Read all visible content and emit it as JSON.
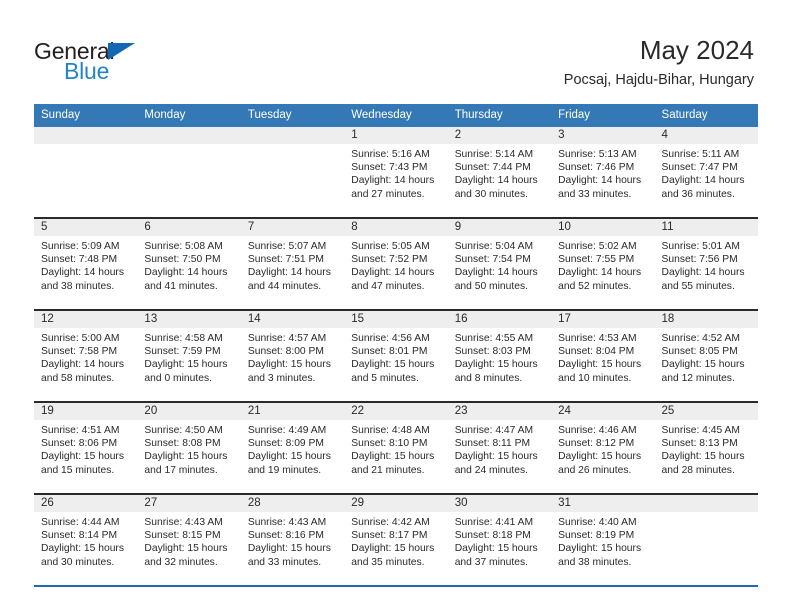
{
  "brand": {
    "name_part1": "General",
    "name_part2": "Blue",
    "accent_color": "#2484c6",
    "triangle_color": "#1268b3"
  },
  "header": {
    "month_title": "May 2024",
    "location": "Pocsaj, Hajdu-Bihar, Hungary"
  },
  "theme": {
    "header_row_color": "#3479b5",
    "daynum_band_color": "#eeeeee",
    "week_divider_color": "#2a2a2a",
    "last_week_divider_color": "#1f6ab0"
  },
  "weekday_headers": [
    "Sunday",
    "Monday",
    "Tuesday",
    "Wednesday",
    "Thursday",
    "Friday",
    "Saturday"
  ],
  "labels": {
    "sunrise": "Sunrise:",
    "sunset": "Sunset:",
    "daylight": "Daylight:"
  },
  "weeks": [
    [
      {
        "day": "",
        "empty": true
      },
      {
        "day": "",
        "empty": true
      },
      {
        "day": "",
        "empty": true
      },
      {
        "day": "1",
        "sunrise": "Sunrise: 5:16 AM",
        "sunset": "Sunset: 7:43 PM",
        "daylight": "Daylight: 14 hours and 27 minutes."
      },
      {
        "day": "2",
        "sunrise": "Sunrise: 5:14 AM",
        "sunset": "Sunset: 7:44 PM",
        "daylight": "Daylight: 14 hours and 30 minutes."
      },
      {
        "day": "3",
        "sunrise": "Sunrise: 5:13 AM",
        "sunset": "Sunset: 7:46 PM",
        "daylight": "Daylight: 14 hours and 33 minutes."
      },
      {
        "day": "4",
        "sunrise": "Sunrise: 5:11 AM",
        "sunset": "Sunset: 7:47 PM",
        "daylight": "Daylight: 14 hours and 36 minutes."
      }
    ],
    [
      {
        "day": "5",
        "sunrise": "Sunrise: 5:09 AM",
        "sunset": "Sunset: 7:48 PM",
        "daylight": "Daylight: 14 hours and 38 minutes."
      },
      {
        "day": "6",
        "sunrise": "Sunrise: 5:08 AM",
        "sunset": "Sunset: 7:50 PM",
        "daylight": "Daylight: 14 hours and 41 minutes."
      },
      {
        "day": "7",
        "sunrise": "Sunrise: 5:07 AM",
        "sunset": "Sunset: 7:51 PM",
        "daylight": "Daylight: 14 hours and 44 minutes."
      },
      {
        "day": "8",
        "sunrise": "Sunrise: 5:05 AM",
        "sunset": "Sunset: 7:52 PM",
        "daylight": "Daylight: 14 hours and 47 minutes."
      },
      {
        "day": "9",
        "sunrise": "Sunrise: 5:04 AM",
        "sunset": "Sunset: 7:54 PM",
        "daylight": "Daylight: 14 hours and 50 minutes."
      },
      {
        "day": "10",
        "sunrise": "Sunrise: 5:02 AM",
        "sunset": "Sunset: 7:55 PM",
        "daylight": "Daylight: 14 hours and 52 minutes."
      },
      {
        "day": "11",
        "sunrise": "Sunrise: 5:01 AM",
        "sunset": "Sunset: 7:56 PM",
        "daylight": "Daylight: 14 hours and 55 minutes."
      }
    ],
    [
      {
        "day": "12",
        "sunrise": "Sunrise: 5:00 AM",
        "sunset": "Sunset: 7:58 PM",
        "daylight": "Daylight: 14 hours and 58 minutes."
      },
      {
        "day": "13",
        "sunrise": "Sunrise: 4:58 AM",
        "sunset": "Sunset: 7:59 PM",
        "daylight": "Daylight: 15 hours and 0 minutes."
      },
      {
        "day": "14",
        "sunrise": "Sunrise: 4:57 AM",
        "sunset": "Sunset: 8:00 PM",
        "daylight": "Daylight: 15 hours and 3 minutes."
      },
      {
        "day": "15",
        "sunrise": "Sunrise: 4:56 AM",
        "sunset": "Sunset: 8:01 PM",
        "daylight": "Daylight: 15 hours and 5 minutes."
      },
      {
        "day": "16",
        "sunrise": "Sunrise: 4:55 AM",
        "sunset": "Sunset: 8:03 PM",
        "daylight": "Daylight: 15 hours and 8 minutes."
      },
      {
        "day": "17",
        "sunrise": "Sunrise: 4:53 AM",
        "sunset": "Sunset: 8:04 PM",
        "daylight": "Daylight: 15 hours and 10 minutes."
      },
      {
        "day": "18",
        "sunrise": "Sunrise: 4:52 AM",
        "sunset": "Sunset: 8:05 PM",
        "daylight": "Daylight: 15 hours and 12 minutes."
      }
    ],
    [
      {
        "day": "19",
        "sunrise": "Sunrise: 4:51 AM",
        "sunset": "Sunset: 8:06 PM",
        "daylight": "Daylight: 15 hours and 15 minutes."
      },
      {
        "day": "20",
        "sunrise": "Sunrise: 4:50 AM",
        "sunset": "Sunset: 8:08 PM",
        "daylight": "Daylight: 15 hours and 17 minutes."
      },
      {
        "day": "21",
        "sunrise": "Sunrise: 4:49 AM",
        "sunset": "Sunset: 8:09 PM",
        "daylight": "Daylight: 15 hours and 19 minutes."
      },
      {
        "day": "22",
        "sunrise": "Sunrise: 4:48 AM",
        "sunset": "Sunset: 8:10 PM",
        "daylight": "Daylight: 15 hours and 21 minutes."
      },
      {
        "day": "23",
        "sunrise": "Sunrise: 4:47 AM",
        "sunset": "Sunset: 8:11 PM",
        "daylight": "Daylight: 15 hours and 24 minutes."
      },
      {
        "day": "24",
        "sunrise": "Sunrise: 4:46 AM",
        "sunset": "Sunset: 8:12 PM",
        "daylight": "Daylight: 15 hours and 26 minutes."
      },
      {
        "day": "25",
        "sunrise": "Sunrise: 4:45 AM",
        "sunset": "Sunset: 8:13 PM",
        "daylight": "Daylight: 15 hours and 28 minutes."
      }
    ],
    [
      {
        "day": "26",
        "sunrise": "Sunrise: 4:44 AM",
        "sunset": "Sunset: 8:14 PM",
        "daylight": "Daylight: 15 hours and 30 minutes."
      },
      {
        "day": "27",
        "sunrise": "Sunrise: 4:43 AM",
        "sunset": "Sunset: 8:15 PM",
        "daylight": "Daylight: 15 hours and 32 minutes."
      },
      {
        "day": "28",
        "sunrise": "Sunrise: 4:43 AM",
        "sunset": "Sunset: 8:16 PM",
        "daylight": "Daylight: 15 hours and 33 minutes."
      },
      {
        "day": "29",
        "sunrise": "Sunrise: 4:42 AM",
        "sunset": "Sunset: 8:17 PM",
        "daylight": "Daylight: 15 hours and 35 minutes."
      },
      {
        "day": "30",
        "sunrise": "Sunrise: 4:41 AM",
        "sunset": "Sunset: 8:18 PM",
        "daylight": "Daylight: 15 hours and 37 minutes."
      },
      {
        "day": "31",
        "sunrise": "Sunrise: 4:40 AM",
        "sunset": "Sunset: 8:19 PM",
        "daylight": "Daylight: 15 hours and 38 minutes."
      },
      {
        "day": "",
        "empty": true
      }
    ]
  ]
}
